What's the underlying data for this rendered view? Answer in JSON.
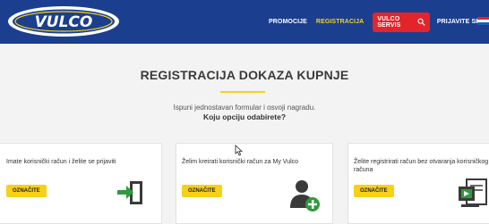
{
  "brand": {
    "logo_text": "VULCO",
    "accent": "#f7d117",
    "header_bg": "#1b3f8e",
    "red": "#e4242b"
  },
  "nav": {
    "items": [
      {
        "label": "PROMOCIJE",
        "active": false
      },
      {
        "label": "REGISTRACIJA",
        "active": true
      },
      {
        "label": "VULCO SERVIS",
        "icon": "search-icon"
      },
      {
        "label": "PRIJAVITE SE",
        "active": false
      }
    ],
    "language_flag": "croatia-flag"
  },
  "main": {
    "title": "REGISTRACIJA DOKAZA KUPNJE",
    "subtitle": "Ispuni jednostavan formular i osvoji nagradu.",
    "question": "Koju opciju odabirete?"
  },
  "cards": [
    {
      "text": "Imate korisnički račun i želite se prijaviti",
      "button": "OZNAČITE",
      "icon": "login-door-icon"
    },
    {
      "text": "Želim kreirati korisnički račun za My Vulco",
      "button": "OZNAČITE",
      "icon": "add-user-icon"
    },
    {
      "text": "Želite registrirati račun bez otvaranja korisničkog računa",
      "button": "OZNAČITE",
      "icon": "document-register-icon"
    }
  ]
}
